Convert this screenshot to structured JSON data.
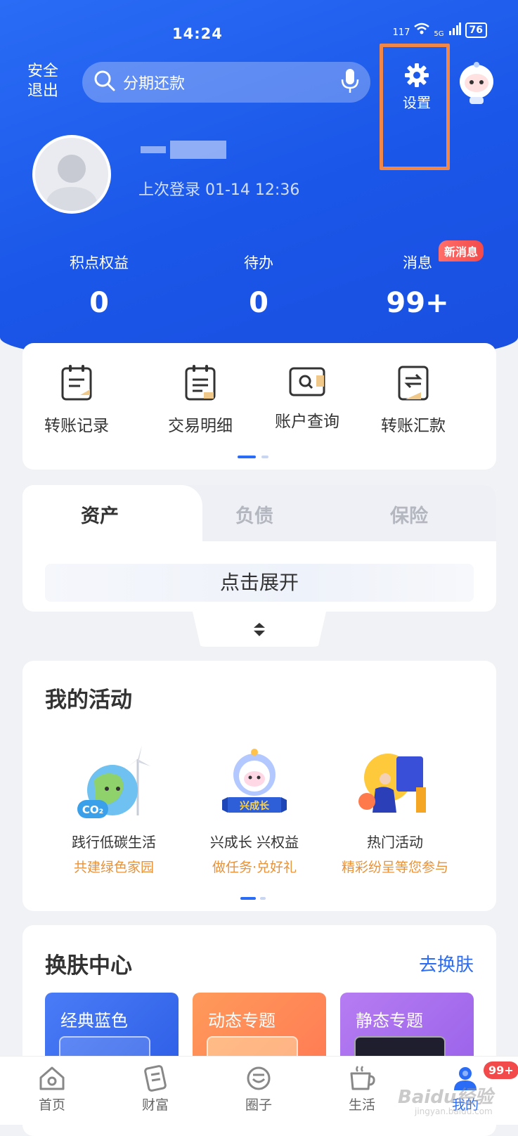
{
  "status_bar": {
    "time": "14:24",
    "network": "117",
    "signal": "5G",
    "battery": "76"
  },
  "header": {
    "safe_exit": "安全\n退出",
    "search_placeholder": "分期还款",
    "settings_label": "设置",
    "last_login": "上次登录 01-14 12:36"
  },
  "stats": [
    {
      "label": "积点权益",
      "value": "0"
    },
    {
      "label": "待办",
      "value": "0"
    },
    {
      "label": "消息",
      "value": "99+"
    }
  ],
  "new_message_badge": "新消息",
  "quick_actions": [
    {
      "label": "转账记录",
      "icon": "transfer-record-icon"
    },
    {
      "label": "交易明细",
      "icon": "transaction-detail-icon"
    },
    {
      "label": "账户查询",
      "icon": "account-query-icon"
    },
    {
      "label": "转账汇款",
      "icon": "remittance-icon"
    }
  ],
  "asset_tabs": [
    "资产",
    "负债",
    "保险"
  ],
  "expand_text": "点击展开",
  "activities": {
    "title": "我的活动",
    "items": [
      {
        "title": "践行低碳生活",
        "subtitle": "共建绿色家园"
      },
      {
        "title": "兴成长 兴权益",
        "subtitle": "做任务·兑好礼"
      },
      {
        "title": "热门活动",
        "subtitle": "精彩纷呈等您参与"
      }
    ],
    "co2_label": "CO₂",
    "growth_label": "兴成长"
  },
  "skin": {
    "title": "换肤中心",
    "link": "去换肤",
    "tiles": [
      "经典蓝色",
      "动态专题",
      "静态专题"
    ]
  },
  "tabbar": {
    "items": [
      "首页",
      "财富",
      "圈子",
      "生活",
      "我的"
    ],
    "badge": "99+"
  },
  "watermark": "Baidu经验",
  "watermark_sub": "jingyan.baidu.com",
  "colors": {
    "brand_blue": "#1a56e8",
    "accent_orange": "#e8923a",
    "highlight_box": "#f2874a",
    "badge_red": "#f24a4a"
  }
}
